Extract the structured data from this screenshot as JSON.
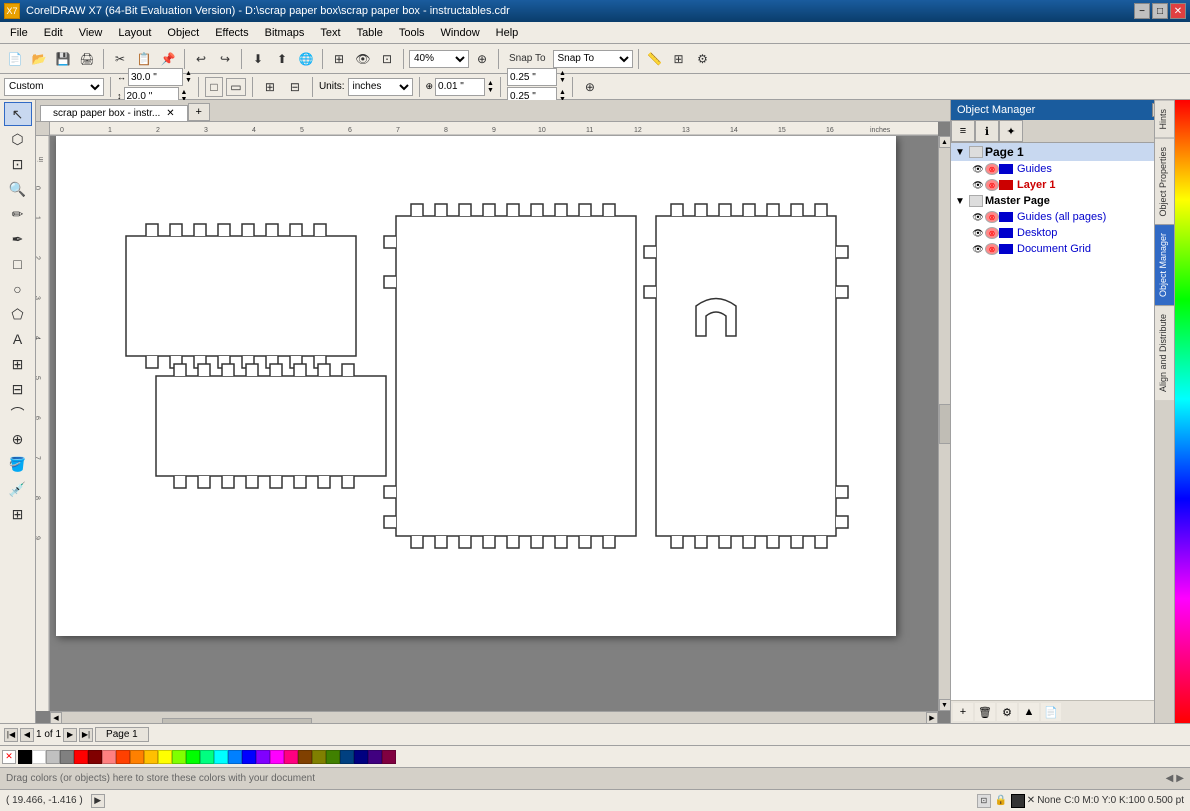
{
  "window": {
    "title": "CorelDRAW X7 (64-Bit Evaluation Version) - D:\\scrap paper box\\scrap paper box - instructables.cdr",
    "title_icon": "C"
  },
  "title_buttons": {
    "minimize": "−",
    "maximize": "□",
    "close": "✕"
  },
  "menu": {
    "items": [
      "File",
      "Edit",
      "View",
      "Layout",
      "Object",
      "Effects",
      "Bitmaps",
      "Text",
      "Table",
      "Tools",
      "Window",
      "Help"
    ]
  },
  "toolbar1": {
    "buttons": [
      "new",
      "open",
      "save",
      "print",
      "cut",
      "copy",
      "paste",
      "undo",
      "redo",
      "import",
      "export",
      "publish"
    ],
    "zoom": "40%"
  },
  "toolbar2": {
    "page_preset": "Custom",
    "width": "30.0 \"",
    "height": "20.0 \"",
    "units": "inches",
    "nudge": "0.01 \"",
    "grid_x": "0.25 \"",
    "grid_y": "0.25 \""
  },
  "canvas": {
    "tab_title": "scrap paper box - instr...",
    "cursor_pos": "( 19.466, -1.416 )"
  },
  "object_manager": {
    "title": "Object Manager",
    "pages": [
      {
        "label": "Page 1",
        "layers": [
          {
            "name": "Guides",
            "color": "#0000cc",
            "visible": true,
            "locked": false
          },
          {
            "name": "Layer 1",
            "color": "#cc0000",
            "visible": true,
            "locked": false
          }
        ]
      }
    ],
    "master_page": {
      "label": "Master Page",
      "layers": [
        {
          "name": "Guides (all pages)",
          "color": "#0000cc"
        },
        {
          "name": "Desktop",
          "color": "#0000cc"
        },
        {
          "name": "Document Grid",
          "color": "#0000cc"
        }
      ]
    },
    "tab_icons": [
      "layers-icon",
      "properties-icon",
      "styles-icon"
    ]
  },
  "side_tabs": [
    "Hints",
    "Object Properties",
    "Object Manager",
    "Align and Distribute"
  ],
  "status_bar": {
    "coords": "( 19.466, -1.416 )",
    "fill_label": "None",
    "stroke": "C:0 M:0 Y:0 K:100  0.500 pt"
  },
  "page_nav": {
    "current": "1",
    "total": "1",
    "page_label": "Page 1"
  },
  "drag_colors": {
    "hint": "Drag colors (or objects) here to store these colors with your document"
  },
  "colors": [
    "#000000",
    "#ffffff",
    "#c0c0c0",
    "#808080",
    "#ff0000",
    "#800000",
    "#ff8080",
    "#ff4000",
    "#ff8000",
    "#ffbf00",
    "#ffff00",
    "#80ff00",
    "#00ff00",
    "#00ff80",
    "#00ffff",
    "#0080ff",
    "#0000ff",
    "#8000ff",
    "#ff00ff",
    "#ff0080",
    "#804000",
    "#808000",
    "#408000",
    "#004080",
    "#000080",
    "#400080",
    "#800040"
  ]
}
